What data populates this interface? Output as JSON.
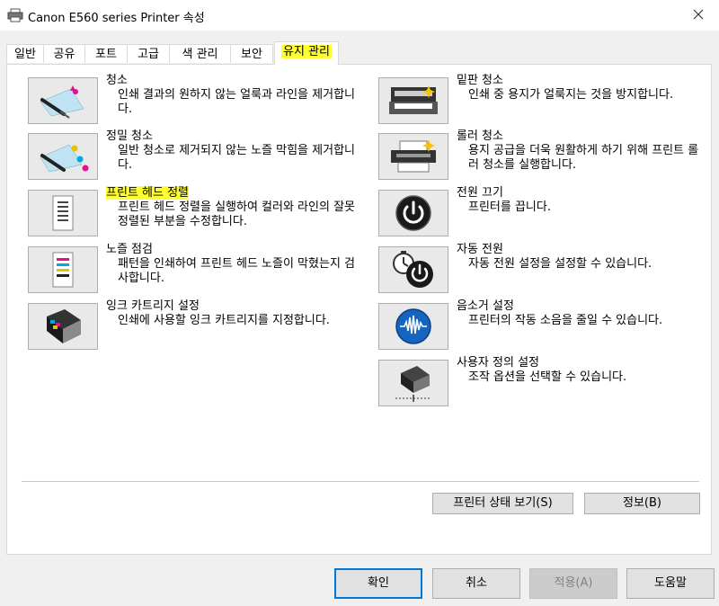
{
  "window": {
    "title": "Canon E560 series Printer 속성"
  },
  "tabs": [
    {
      "label": "일반"
    },
    {
      "label": "공유"
    },
    {
      "label": "포트"
    },
    {
      "label": "고급"
    },
    {
      "label": "색 관리"
    },
    {
      "label": "보안"
    },
    {
      "label": "유지 관리"
    }
  ],
  "left_items": [
    {
      "title": "청소",
      "desc": "인쇄 결과의 원하지 않는 얼룩과 라인을 제거합니다."
    },
    {
      "title": "정밀 청소",
      "desc": "일반 청소로 제거되지 않는 노즐 막힘을 제거합니다."
    },
    {
      "title": "프린트 헤드 정렬",
      "desc": "프린트 헤드 정렬을 실행하여 컬러와 라인의 잘못 정렬된 부분을 수정합니다."
    },
    {
      "title": "노즐 점검",
      "desc": "패턴을 인쇄하여 프린트 헤드 노즐이 막혔는지 검사합니다."
    },
    {
      "title": "잉크 카트리지 설정",
      "desc": "인쇄에 사용할 잉크 카트리지를 지정합니다."
    }
  ],
  "right_items": [
    {
      "title": "밑판 청소",
      "desc": "인쇄 중 용지가 얼룩지는 것을 방지합니다."
    },
    {
      "title": "롤러 청소",
      "desc": "용지 공급을 더욱 원활하게 하기 위해 프린트 롤러 청소를 실행합니다."
    },
    {
      "title": "전원 끄기",
      "desc": "프린터를 끕니다."
    },
    {
      "title": "자동 전원",
      "desc": "자동 전원 설정을 설정할 수 있습니다."
    },
    {
      "title": "음소거 설정",
      "desc": "프린터의 작동 소음을 줄일 수 있습니다."
    },
    {
      "title": "사용자 정의 설정",
      "desc": "조작 옵션을 선택할 수 있습니다."
    }
  ],
  "panel_buttons": {
    "status": "프린터 상태 보기(S)",
    "info": "정보(B)"
  },
  "footer": {
    "ok": "확인",
    "cancel": "취소",
    "apply": "적용(A)",
    "help": "도움말"
  },
  "colors": {
    "highlight": "#ffff33",
    "focus": "#0078d7",
    "power": "#1a1a1a",
    "sound": "#1565c0"
  }
}
